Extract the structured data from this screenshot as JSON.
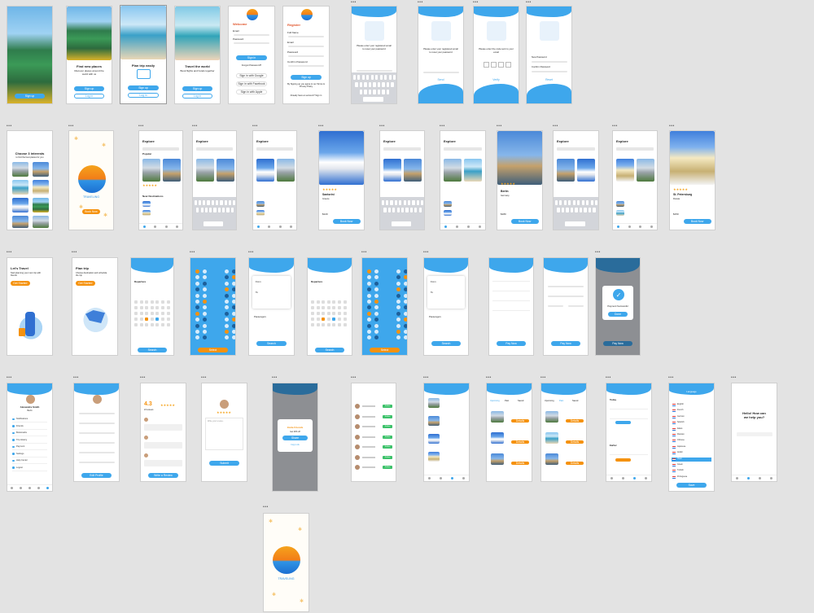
{
  "app": {
    "brand": "TRAVELING",
    "accent": "#3ea7ec",
    "orange": "#f5920f",
    "canvas_bg": "#e3e3e3"
  },
  "frame_label": "•••",
  "status_time": "9:41",
  "onboarding": [
    {
      "title": "Find new places",
      "body": "Discover places around the world with us",
      "btn": "Sign up",
      "alt": "Log in"
    },
    {
      "title": "Plan trip easily",
      "body": "Plan your trip in a few taps",
      "btn": "Sign up",
      "alt": "Log in"
    },
    {
      "title": "Travel the world",
      "body": "Book flights and hotels together",
      "btn": "Sign up",
      "alt": "Log in"
    }
  ],
  "login": {
    "title": "Welcome",
    "user_label": "Email",
    "user_value": "your email",
    "pass_label": "Password",
    "btn": "Sign in",
    "forgot": "Forgot Password?",
    "google": "Sign in with Google",
    "facebook": "Sign in with Facebook",
    "apple": "Sign in with Apple"
  },
  "register": {
    "title": "Register",
    "full_name": "Full Name",
    "email": "Email",
    "password": "Password",
    "confirm": "Confirm Password",
    "btn": "Sign up",
    "terms": "By Signing up you agree to our Terms & Privacy Policy",
    "have_account": "Already have an account? Sign in"
  },
  "forgot": {
    "title": "Forgot password",
    "body": "Please enter your registered email to reset your password",
    "field": "Email Address",
    "btn": "Send"
  },
  "verify": {
    "title": "Verification",
    "body": "Please enter the code sent to your email",
    "btn": "Verify",
    "resend": "Resend"
  },
  "reset": {
    "title": "Reset password",
    "new": "New Password",
    "confirm": "Confirm Password",
    "btn": "Reset"
  },
  "interests": {
    "title": "Choose 3 interests",
    "sub": "to find the best places for you"
  },
  "explore": {
    "title": "Explore",
    "search": "Search",
    "section_popular": "Popular",
    "tabs": [
      "Popular",
      "Recommended",
      "Featured",
      "Deals"
    ],
    "section_near": "Near Destinations",
    "keyboard_row1": [
      "q",
      "w",
      "e",
      "r",
      "t",
      "y",
      "u",
      "i",
      "o",
      "p"
    ]
  },
  "places": [
    {
      "name": "Santorini",
      "country": "Greece",
      "price": "$120"
    },
    {
      "name": "Berlin",
      "country": "Germany",
      "price": "$180"
    },
    {
      "name": "St. Petersburg",
      "country": "Russia",
      "price": "$150"
    },
    {
      "name": "Neuschwanstein",
      "country": "Germany",
      "price": "$140"
    }
  ],
  "detail_btn": "Book Now",
  "detail_rating": "★★★★★",
  "plan": [
    {
      "title": "Let's Travel",
      "body": "Start planning your next trip with friends",
      "btn": "Get Started"
    },
    {
      "title": "Plan trip",
      "body": "Choose destination and schedule the trip",
      "btn": "Get Started"
    }
  ],
  "booking": {
    "title": "Flight",
    "from": "From",
    "to": "To",
    "date": "Departure",
    "passengers": "Passengers",
    "btn": "Search",
    "seat_btn": "Select",
    "confirm_btn": "Pay Now",
    "success": "Payment Successful",
    "done_btn": "Done"
  },
  "profile": {
    "name": "Alexandra Smith",
    "location": "Berlin",
    "items": [
      "Notifications",
      "Friends",
      "Bookmarks",
      "Trip History",
      "Payment",
      "Settings",
      "Help Center",
      "Logout"
    ],
    "btn": "Edit Profile"
  },
  "reviews": {
    "score": "4.3",
    "count": "24 reviews",
    "btn": "Write a Review",
    "stars": "★★★★★"
  },
  "write_review": {
    "placeholder": "Write your review...",
    "btn": "Submit"
  },
  "invite": {
    "title": "Invite Friends",
    "sub": "Get 20% off",
    "btn": "Share",
    "alt": "Copy Link"
  },
  "friends": {
    "follow": "Follow"
  },
  "trips": {
    "tabs": [
      "Upcoming",
      "Past",
      "Saved"
    ],
    "btn": "Details"
  },
  "notifications": {
    "title": "Notifications",
    "today": "Today",
    "earlier": "Earlier"
  },
  "language": {
    "title": "Language",
    "items": [
      "English",
      "French",
      "German",
      "Spanish",
      "Italian",
      "Russian",
      "Chinese",
      "Japanese",
      "Arabic",
      "Hindi",
      "Greek",
      "Turkish",
      "Portuguese"
    ],
    "btn": "Save"
  },
  "help": {
    "title": "Hello! How can we help you?",
    "search": "Search"
  }
}
